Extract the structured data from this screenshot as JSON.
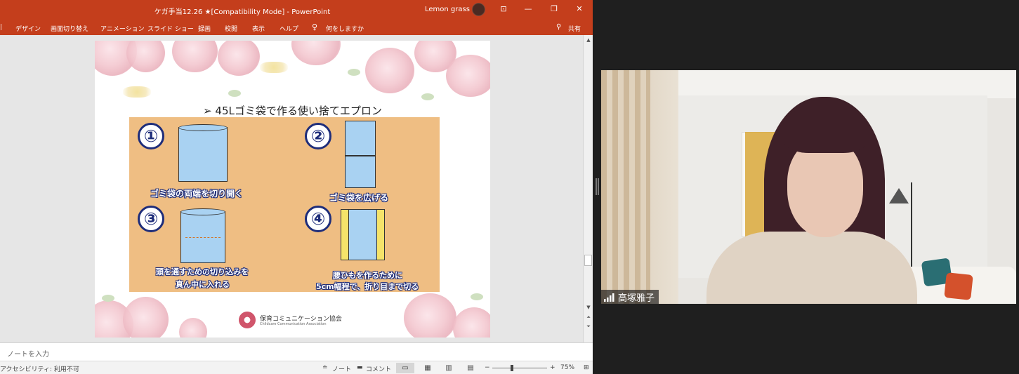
{
  "powerpoint": {
    "title": "ケガ手当12.26 ★[Compatibility Mode]  -  PowerPoint",
    "user_name": "Lemon grass",
    "ribbon_tabs": [
      "デザイン",
      "画面切り替え",
      "アニメーション",
      "スライド ショー",
      "録画",
      "校閲",
      "表示",
      "ヘルプ"
    ],
    "tell_me": "何をしますか",
    "share": "共有",
    "notes_placeholder": "ノートを入力",
    "status": {
      "accessibility": "アクセシビリティ: 利用不可",
      "notes_btn": "ノート",
      "comments_btn": "コメント",
      "zoom": "75%"
    }
  },
  "slide": {
    "title": "➢ 45Lゴミ袋で作る使い捨てエプロン",
    "steps": [
      {
        "num": "①",
        "caption": "ゴミ袋の両端を切り開く"
      },
      {
        "num": "②",
        "caption": "ゴミ袋を広げる"
      },
      {
        "num": "③",
        "caption_line1": "頭を通すための切り込みを",
        "caption_line2": "真ん中に入れる"
      },
      {
        "num": "④",
        "caption_line1": "腰ひもを作るために",
        "caption_line2": "5cm幅程で、折り目まで切る"
      }
    ],
    "org_name": "保育コミュニケーション協会",
    "org_sub": "Childcare Communication Association"
  },
  "video": {
    "participant_name": "高塚雅子"
  },
  "colors": {
    "ppt_accent": "#c43e1c",
    "step_blue": "#1e2d7a",
    "cork": "#efbe83",
    "bag_blue": "#a9d2f2"
  }
}
